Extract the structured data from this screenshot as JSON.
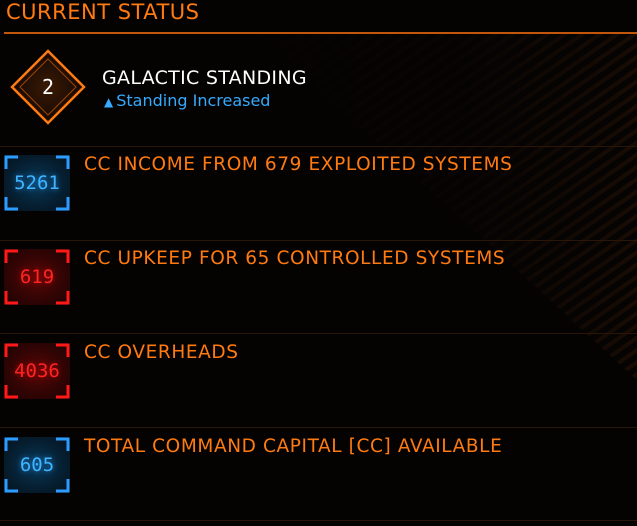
{
  "panel": {
    "title": "CURRENT STATUS"
  },
  "standing": {
    "rank": "2",
    "title": "GALACTIC STANDING",
    "subtitle_arrow": "▲",
    "subtitle": "Standing Increased"
  },
  "rows": [
    {
      "value": "5261",
      "label": "CC INCOME FROM 679 EXPLOITED SYSTEMS",
      "color": "blue"
    },
    {
      "value": "619",
      "label": "CC UPKEEP FOR 65 CONTROLLED SYSTEMS",
      "color": "red"
    },
    {
      "value": "4036",
      "label": "CC OVERHEADS",
      "color": "red"
    },
    {
      "value": "605",
      "label": "TOTAL COMMAND CAPITAL [CC] AVAILABLE",
      "color": "blue"
    }
  ],
  "colors": {
    "accent_orange": "#ff7a10",
    "positive_blue": "#3fb4ff",
    "negative_red": "#ff2424",
    "background": "#050302"
  }
}
